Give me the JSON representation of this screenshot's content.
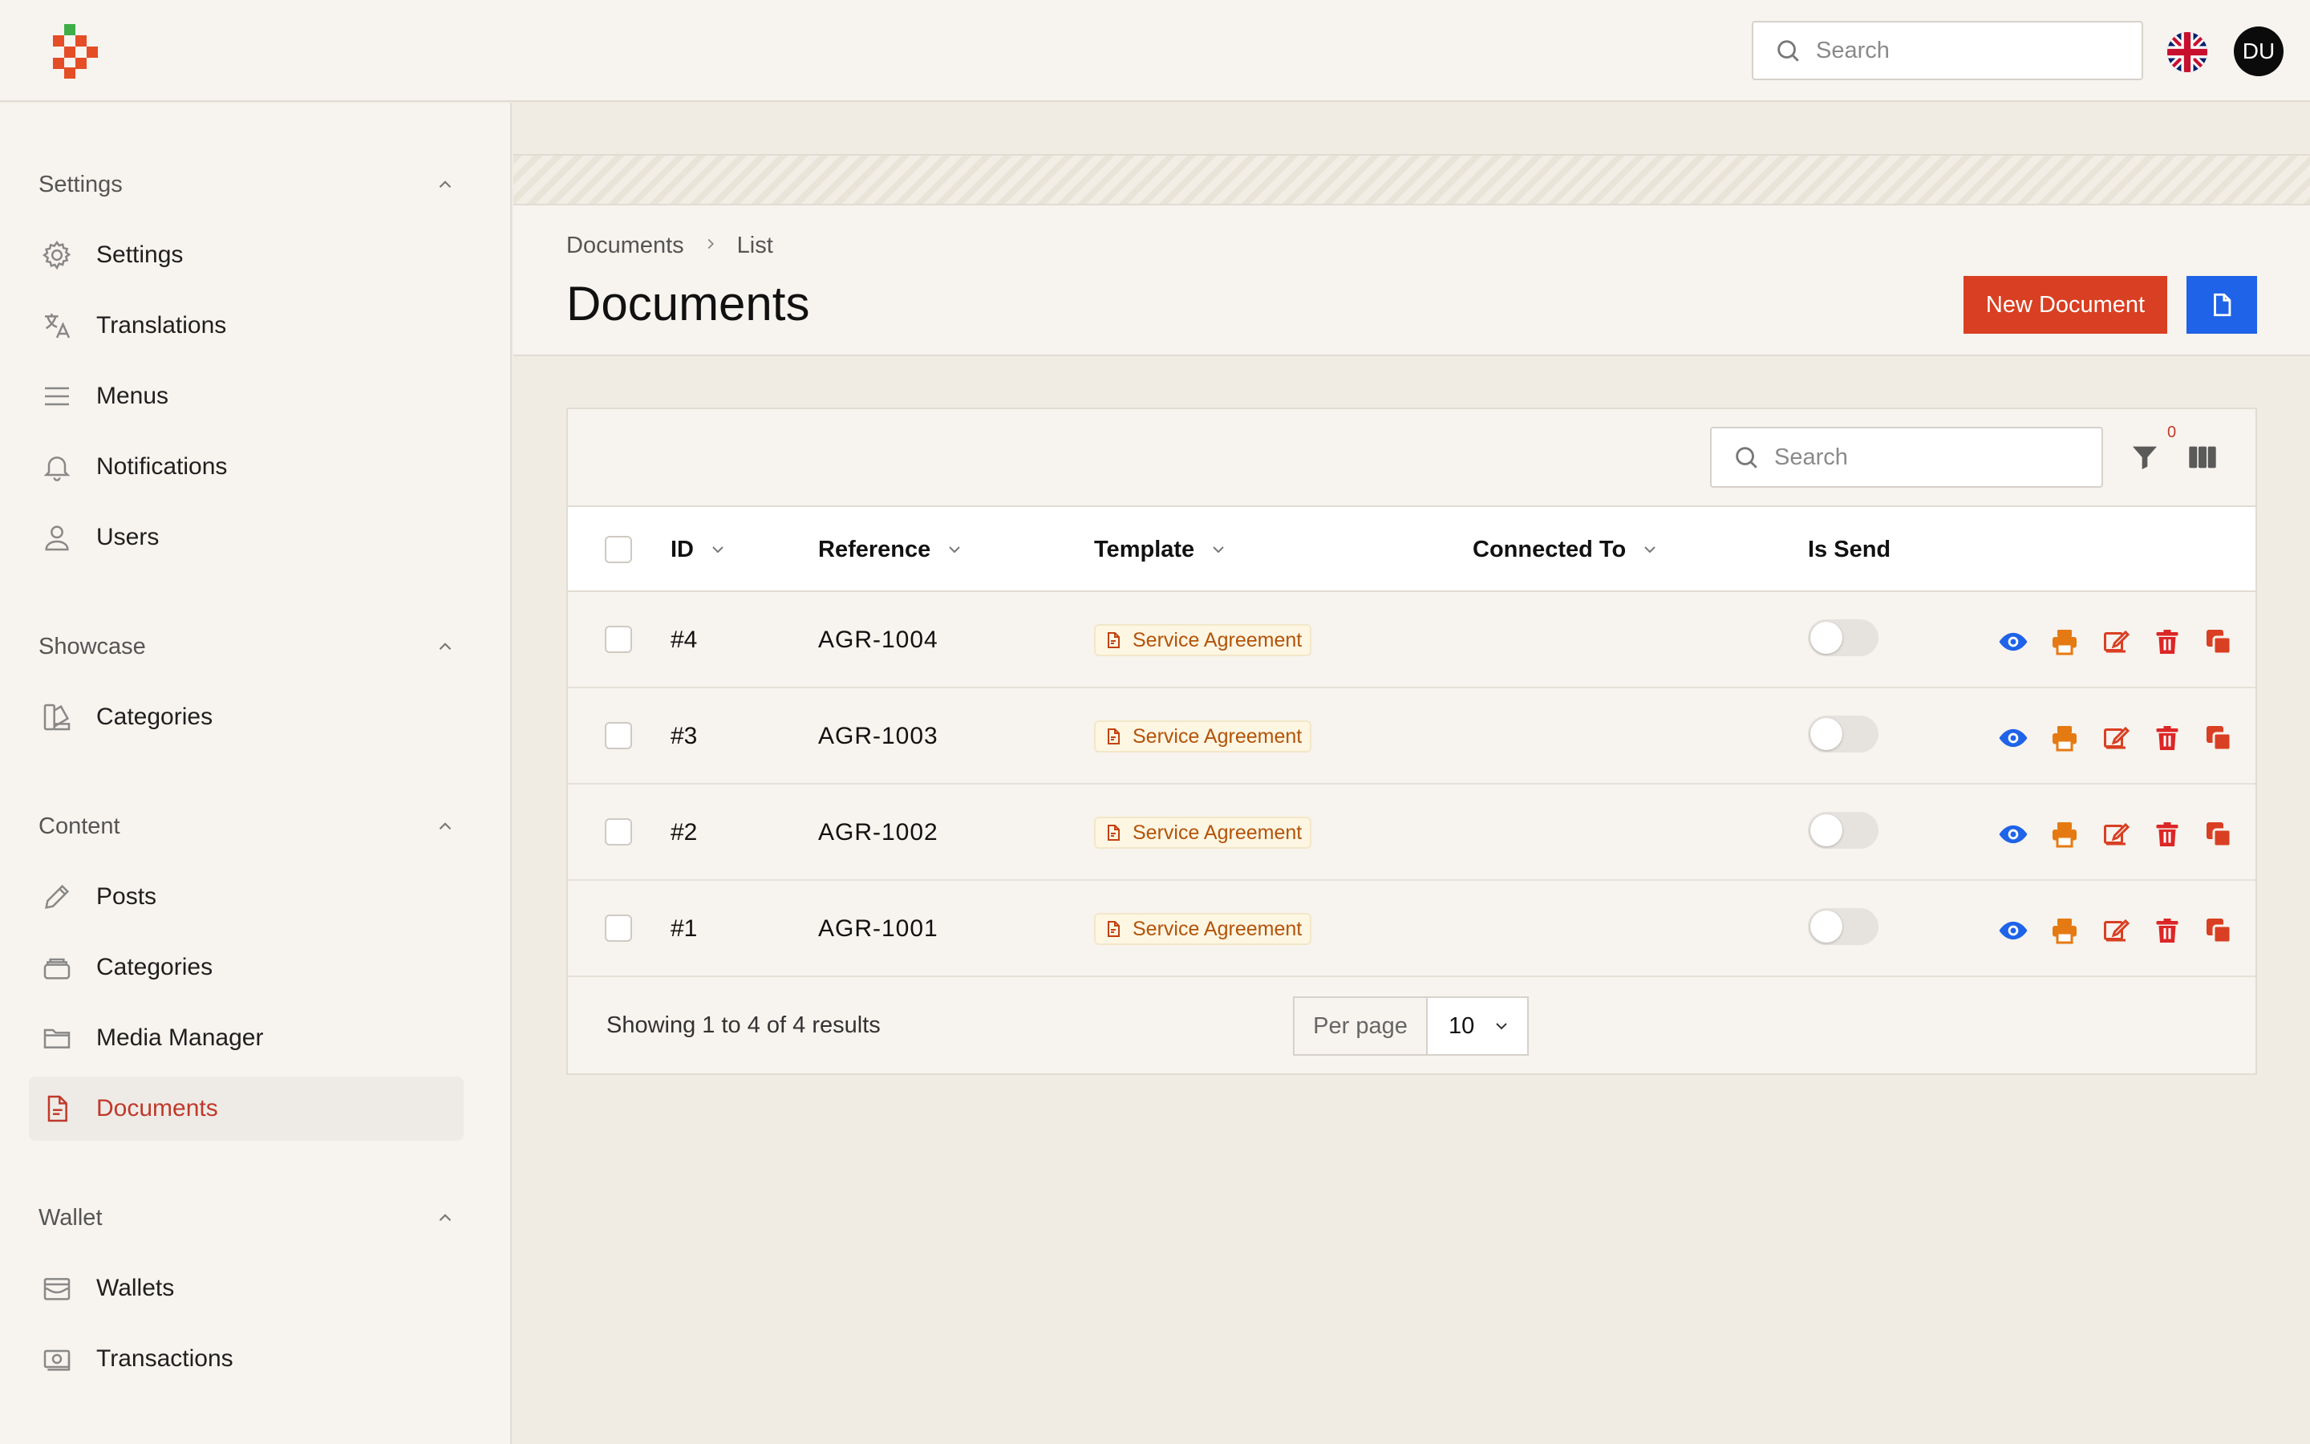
{
  "top": {
    "search_placeholder": "Search",
    "avatar_initials": "DU",
    "language": "English (UK)"
  },
  "sidebar": {
    "groups": [
      {
        "title": "Settings",
        "items": [
          {
            "label": "Settings",
            "icon": "gear-icon"
          },
          {
            "label": "Translations",
            "icon": "translate-icon"
          },
          {
            "label": "Menus",
            "icon": "menu-icon"
          },
          {
            "label": "Notifications",
            "icon": "bell-icon"
          },
          {
            "label": "Users",
            "icon": "user-icon"
          }
        ]
      },
      {
        "title": "Showcase",
        "items": [
          {
            "label": "Categories",
            "icon": "swatch-icon"
          }
        ]
      },
      {
        "title": "Content",
        "items": [
          {
            "label": "Posts",
            "icon": "pencil-icon"
          },
          {
            "label": "Categories",
            "icon": "stack-icon"
          },
          {
            "label": "Media Manager",
            "icon": "folder-icon"
          },
          {
            "label": "Documents",
            "icon": "document-icon",
            "active": true
          }
        ]
      },
      {
        "title": "Wallet",
        "items": [
          {
            "label": "Wallets",
            "icon": "wallet-icon"
          },
          {
            "label": "Transactions",
            "icon": "cash-icon"
          }
        ]
      }
    ]
  },
  "header": {
    "breadcrumb": [
      "Documents",
      "List"
    ],
    "title": "Documents",
    "new_button": "New Document"
  },
  "table": {
    "search_placeholder": "Search",
    "filter_count": "0",
    "columns": [
      "ID",
      "Reference",
      "Template",
      "Connected To",
      "Is Send"
    ],
    "rows": [
      {
        "id": "#4",
        "reference": "AGR-1004",
        "template": "Service Agreement",
        "connected_to": "",
        "is_send": false
      },
      {
        "id": "#3",
        "reference": "AGR-1003",
        "template": "Service Agreement",
        "connected_to": "",
        "is_send": false
      },
      {
        "id": "#2",
        "reference": "AGR-1002",
        "template": "Service Agreement",
        "connected_to": "",
        "is_send": false
      },
      {
        "id": "#1",
        "reference": "AGR-1001",
        "template": "Service Agreement",
        "connected_to": "",
        "is_send": false
      }
    ],
    "showing": "Showing 1 to 4 of 4 results",
    "per_page_label": "Per page",
    "per_page_value": "10"
  },
  "colors": {
    "accent_red": "#d93f22",
    "accent_blue": "#1e63e8",
    "badge_text": "#b45309"
  }
}
